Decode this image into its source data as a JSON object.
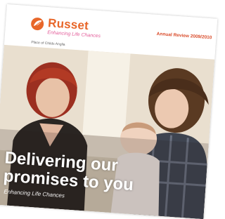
{
  "brand": {
    "name": "Russet",
    "tagline": "Enhancing Life Chances",
    "color_brand": "#e8672a",
    "color_tagline": "#e35d9a"
  },
  "header": {
    "report_title": "Annual Review 2009/2010",
    "place_line": "Place of Childs Anglia"
  },
  "cover": {
    "headline_line1": "Delivering our",
    "headline_line2": "promises to you",
    "footer_tagline": "Enhancing Life Chances"
  }
}
